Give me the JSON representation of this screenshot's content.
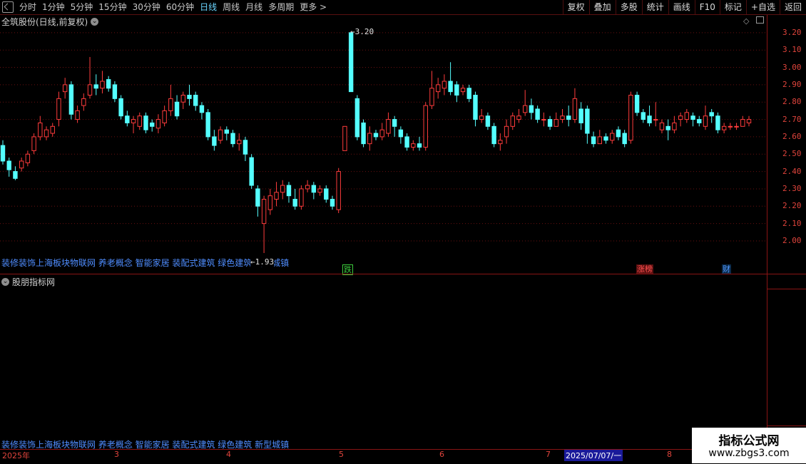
{
  "toolbar": {
    "periods": [
      "分时",
      "1分钟",
      "5分钟",
      "15分钟",
      "30分钟",
      "60分钟",
      "日线",
      "周线",
      "月线",
      "多周期",
      "更多 >"
    ],
    "active_period": "日线",
    "buttons": [
      "复权",
      "叠加",
      "多股",
      "统计",
      "画线",
      "F10",
      "标记",
      "+自选",
      "返回"
    ]
  },
  "main_panel": {
    "title": "全筑股份(日线,前复权)",
    "high_label": "3.20",
    "low_label": "1.93",
    "tags": "装修装饰上海板块物联网 养老概念 智能家居 装配式建筑 绿色建筑 新型城镇",
    "markers": [
      {
        "text": "跌",
        "color": "#3ccc3c"
      },
      {
        "text": "涨榜",
        "color": "#ff5050"
      },
      {
        "text": "财",
        "color": "#5599ff"
      }
    ],
    "price_labels": [
      "3.20",
      "3.10",
      "3.00",
      "2.90",
      "2.80",
      "2.70",
      "2.60",
      "2.50",
      "2.40",
      "2.30",
      "2.20",
      "2.10",
      "2.00"
    ]
  },
  "indicator_panel": {
    "title": "股朋指标网",
    "tags": "装修装饰上海板块物联网 养老概念 智能家居 装配式建筑 绿色建筑 新型城镇"
  },
  "date_axis": {
    "labels": [
      "2025年",
      "3",
      "4",
      "5",
      "6",
      "7",
      "2025/07/07/一",
      "8"
    ]
  },
  "watermark": {
    "line1": "指标公式网",
    "line2": "www.zbgs3.com"
  },
  "chart_data": {
    "type": "candlestick",
    "ylim": [
      1.93,
      3.22
    ],
    "ticks": [
      2.0,
      2.1,
      2.2,
      2.3,
      2.4,
      2.5,
      2.6,
      2.7,
      2.8,
      2.9,
      3.0,
      3.1,
      3.2
    ],
    "up_color": "#ff3c3c",
    "down_color": "#54ffff",
    "candles": [
      [
        2.55,
        2.46,
        2.58,
        2.44
      ],
      [
        2.46,
        2.41,
        2.48,
        2.37
      ],
      [
        2.4,
        2.36,
        2.43,
        2.35
      ],
      [
        2.42,
        2.46,
        2.48,
        2.4
      ],
      [
        2.45,
        2.5,
        2.52,
        2.43
      ],
      [
        2.52,
        2.6,
        2.62,
        2.5
      ],
      [
        2.6,
        2.68,
        2.72,
        2.58
      ],
      [
        2.6,
        2.64,
        2.66,
        2.58
      ],
      [
        2.62,
        2.66,
        2.68,
        2.6
      ],
      [
        2.7,
        2.82,
        2.86,
        2.66
      ],
      [
        2.86,
        2.9,
        2.94,
        2.82
      ],
      [
        2.9,
        2.73,
        2.92,
        2.7
      ],
      [
        2.7,
        2.75,
        2.78,
        2.68
      ],
      [
        2.78,
        2.82,
        2.85,
        2.75
      ],
      [
        2.84,
        2.9,
        3.06,
        2.82
      ],
      [
        2.9,
        2.88,
        2.96,
        2.84
      ],
      [
        2.88,
        2.92,
        2.98,
        2.85
      ],
      [
        2.93,
        2.88,
        2.95,
        2.86
      ],
      [
        2.9,
        2.82,
        2.92,
        2.8
      ],
      [
        2.82,
        2.72,
        2.84,
        2.7
      ],
      [
        2.72,
        2.68,
        2.75,
        2.66
      ],
      [
        2.68,
        2.7,
        2.72,
        2.62
      ],
      [
        2.66,
        2.72,
        2.74,
        2.64
      ],
      [
        2.72,
        2.64,
        2.74,
        2.62
      ],
      [
        2.68,
        2.66,
        2.7,
        2.63
      ],
      [
        2.65,
        2.7,
        2.73,
        2.62
      ],
      [
        2.68,
        2.75,
        2.78,
        2.66
      ],
      [
        2.75,
        2.82,
        2.9,
        2.72
      ],
      [
        2.8,
        2.72,
        2.84,
        2.7
      ],
      [
        2.8,
        2.84,
        2.86,
        2.76
      ],
      [
        2.84,
        2.82,
        2.9,
        2.78
      ],
      [
        2.84,
        2.78,
        2.86,
        2.75
      ],
      [
        2.78,
        2.74,
        2.8,
        2.7
      ],
      [
        2.74,
        2.6,
        2.76,
        2.58
      ],
      [
        2.6,
        2.55,
        2.64,
        2.52
      ],
      [
        2.58,
        2.64,
        2.66,
        2.56
      ],
      [
        2.64,
        2.62,
        2.66,
        2.58
      ],
      [
        2.62,
        2.56,
        2.64,
        2.54
      ],
      [
        2.56,
        2.58,
        2.62,
        2.52
      ],
      [
        2.58,
        2.5,
        2.6,
        2.46
      ],
      [
        2.48,
        2.32,
        2.5,
        2.3
      ],
      [
        2.3,
        2.2,
        2.32,
        2.14
      ],
      [
        2.1,
        2.24,
        2.26,
        1.93
      ],
      [
        2.18,
        2.26,
        2.3,
        2.15
      ],
      [
        2.24,
        2.28,
        2.34,
        2.2
      ],
      [
        2.28,
        2.32,
        2.35,
        2.24
      ],
      [
        2.32,
        2.26,
        2.34,
        2.22
      ],
      [
        2.24,
        2.2,
        2.3,
        2.18
      ],
      [
        2.2,
        2.3,
        2.32,
        2.18
      ],
      [
        2.3,
        2.32,
        2.35,
        2.28
      ],
      [
        2.32,
        2.28,
        2.34,
        2.24
      ],
      [
        2.28,
        2.3,
        2.32,
        2.26
      ],
      [
        2.3,
        2.24,
        2.32,
        2.22
      ],
      [
        2.24,
        2.2,
        2.26,
        2.18
      ],
      [
        2.18,
        2.4,
        2.42,
        2.16
      ],
      [
        2.52,
        2.66,
        2.66,
        2.52
      ],
      [
        3.2,
        2.86,
        3.2,
        2.86
      ],
      [
        2.82,
        2.6,
        2.84,
        2.58
      ],
      [
        2.68,
        2.56,
        2.7,
        2.54
      ],
      [
        2.56,
        2.62,
        2.66,
        2.52
      ],
      [
        2.62,
        2.6,
        2.64,
        2.58
      ],
      [
        2.6,
        2.64,
        2.68,
        2.58
      ],
      [
        2.62,
        2.7,
        2.74,
        2.6
      ],
      [
        2.7,
        2.66,
        2.72,
        2.6
      ],
      [
        2.64,
        2.6,
        2.66,
        2.56
      ],
      [
        2.6,
        2.54,
        2.62,
        2.52
      ],
      [
        2.54,
        2.56,
        2.58,
        2.52
      ],
      [
        2.56,
        2.54,
        2.6,
        2.52
      ],
      [
        2.54,
        2.78,
        2.8,
        2.52
      ],
      [
        2.78,
        2.88,
        2.98,
        2.76
      ],
      [
        2.86,
        2.9,
        2.94,
        2.82
      ],
      [
        2.88,
        2.92,
        2.96,
        2.84
      ],
      [
        2.92,
        2.86,
        3.03,
        2.84
      ],
      [
        2.9,
        2.84,
        2.92,
        2.8
      ],
      [
        2.86,
        2.88,
        2.9,
        2.84
      ],
      [
        2.88,
        2.82,
        2.9,
        2.8
      ],
      [
        2.84,
        2.7,
        2.86,
        2.66
      ],
      [
        2.7,
        2.72,
        2.76,
        2.68
      ],
      [
        2.72,
        2.66,
        2.74,
        2.64
      ],
      [
        2.66,
        2.56,
        2.68,
        2.54
      ],
      [
        2.56,
        2.58,
        2.62,
        2.52
      ],
      [
        2.6,
        2.66,
        2.7,
        2.56
      ],
      [
        2.66,
        2.72,
        2.74,
        2.64
      ],
      [
        2.7,
        2.72,
        2.76,
        2.68
      ],
      [
        2.74,
        2.78,
        2.87,
        2.72
      ],
      [
        2.78,
        2.74,
        2.82,
        2.7
      ],
      [
        2.76,
        2.7,
        2.78,
        2.68
      ],
      [
        2.7,
        2.7,
        2.74,
        2.66
      ],
      [
        2.7,
        2.66,
        2.72,
        2.64
      ],
      [
        2.66,
        2.7,
        2.74,
        2.66
      ],
      [
        2.7,
        2.72,
        2.76,
        2.68
      ],
      [
        2.72,
        2.7,
        2.78,
        2.66
      ],
      [
        2.7,
        2.82,
        2.88,
        2.68
      ],
      [
        2.76,
        2.68,
        2.8,
        2.64
      ],
      [
        2.76,
        2.62,
        2.78,
        2.56
      ],
      [
        2.6,
        2.56,
        2.63,
        2.54
      ],
      [
        2.56,
        2.6,
        2.64,
        2.56
      ],
      [
        2.6,
        2.58,
        2.62,
        2.56
      ],
      [
        2.58,
        2.62,
        2.64,
        2.56
      ],
      [
        2.64,
        2.6,
        2.66,
        2.58
      ],
      [
        2.62,
        2.56,
        2.64,
        2.54
      ],
      [
        2.58,
        2.84,
        2.86,
        2.56
      ],
      [
        2.84,
        2.74,
        2.86,
        2.72
      ],
      [
        2.74,
        2.7,
        2.76,
        2.68
      ],
      [
        2.72,
        2.68,
        2.78,
        2.66
      ],
      [
        2.7,
        2.7,
        2.8,
        2.66
      ],
      [
        2.64,
        2.68,
        2.7,
        2.62
      ],
      [
        2.66,
        2.64,
        2.7,
        2.58
      ],
      [
        2.64,
        2.68,
        2.72,
        2.62
      ],
      [
        2.7,
        2.72,
        2.74,
        2.66
      ],
      [
        2.7,
        2.74,
        2.76,
        2.68
      ],
      [
        2.72,
        2.7,
        2.74,
        2.66
      ],
      [
        2.7,
        2.68,
        2.72,
        2.66
      ],
      [
        2.66,
        2.72,
        2.78,
        2.64
      ],
      [
        2.74,
        2.72,
        2.76,
        2.68
      ],
      [
        2.72,
        2.64,
        2.74,
        2.62
      ],
      [
        2.64,
        2.66,
        2.68,
        2.62
      ],
      [
        2.66,
        2.66,
        2.68,
        2.64
      ],
      [
        2.66,
        2.66,
        2.68,
        2.64
      ],
      [
        2.66,
        2.7,
        2.72,
        2.66
      ],
      [
        2.68,
        2.7,
        2.72,
        2.66
      ]
    ]
  }
}
